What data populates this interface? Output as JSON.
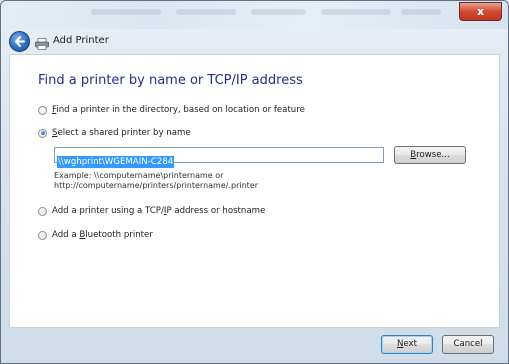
{
  "window": {
    "close_label": "x",
    "title": "Add Printer"
  },
  "heading": "Find a printer by name or TCP/IP address",
  "options": [
    {
      "prefix": "",
      "accel": "F",
      "rest": "ind a printer in the directory, based on location or feature",
      "checked": false
    },
    {
      "prefix": "",
      "accel": "S",
      "rest": "elect a shared printer by name",
      "checked": true
    },
    {
      "prefix": "Add a printer using a TCP/",
      "accel": "I",
      "rest": "P address or hostname",
      "checked": false
    },
    {
      "prefix": "Add a ",
      "accel": "B",
      "rest": "luetooth printer",
      "checked": false
    }
  ],
  "printer_path": "\\\\wghprint\\WGEMAIN-C284",
  "browse_button": {
    "accel": "B",
    "rest": "rowse..."
  },
  "example": {
    "line1": "Example: \\\\computername\\printername or",
    "line2": "http://computername/printers/printername/.printer"
  },
  "buttons": {
    "next": {
      "accel": "N",
      "rest": "ext"
    },
    "cancel": "Cancel"
  },
  "colors": {
    "heading": "#1e3287",
    "selection": "#3399ff",
    "close": "#d34a35"
  }
}
